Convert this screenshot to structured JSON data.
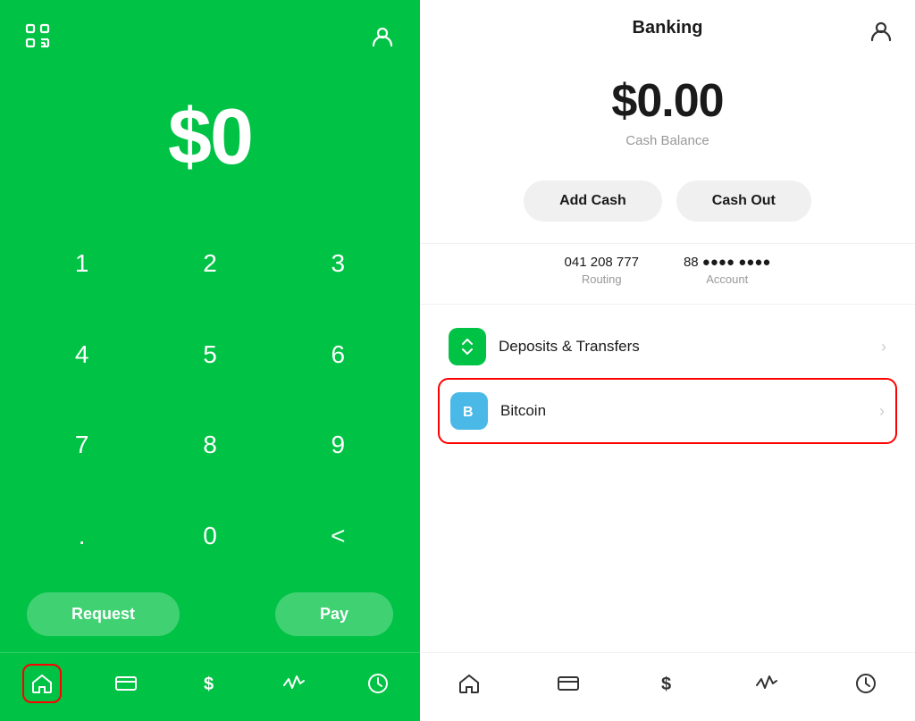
{
  "left": {
    "amount": "$0",
    "numpad": [
      "1",
      "2",
      "3",
      "4",
      "5",
      "6",
      "7",
      "8",
      "9",
      ".",
      "0",
      "⌫"
    ],
    "request_label": "Request",
    "pay_label": "Pay",
    "nav": [
      {
        "name": "home",
        "label": "Home",
        "active": true
      },
      {
        "name": "card",
        "label": "Card"
      },
      {
        "name": "dollar",
        "label": "Dollar"
      },
      {
        "name": "activity",
        "label": "Activity"
      },
      {
        "name": "clock",
        "label": "Clock"
      }
    ]
  },
  "right": {
    "title": "Banking",
    "balance": "$0.00",
    "balance_label": "Cash Balance",
    "add_cash": "Add Cash",
    "cash_out": "Cash Out",
    "routing_number": "041 208 777",
    "routing_label": "Routing",
    "account_number": "88 ●●●● ●●●●",
    "account_label": "Account",
    "menu_items": [
      {
        "id": "deposits",
        "icon_type": "green",
        "label": "Deposits & Transfers",
        "highlighted": false
      },
      {
        "id": "bitcoin",
        "icon_type": "blue",
        "label": "Bitcoin",
        "highlighted": true
      }
    ],
    "nav": [
      {
        "name": "home",
        "label": "Home"
      },
      {
        "name": "card",
        "label": "Card"
      },
      {
        "name": "dollar",
        "label": "Dollar"
      },
      {
        "name": "activity",
        "label": "Activity"
      },
      {
        "name": "clock",
        "label": "Clock"
      }
    ]
  },
  "colors": {
    "green": "#00C244",
    "red_border": "#e00"
  }
}
